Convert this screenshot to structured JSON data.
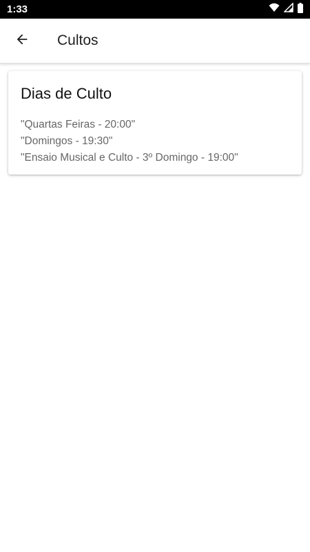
{
  "status_bar": {
    "time": "1:33",
    "icons": [
      "wifi-icon",
      "signal-icon",
      "battery-icon"
    ]
  },
  "app_bar": {
    "back_icon": "arrow-left-icon",
    "title": "Cultos"
  },
  "card": {
    "title": "Dias de Culto",
    "items": [
      "\"Quartas Feiras - 20:00\"",
      "\"Domingos - 19:30\"",
      "\"Ensaio Musical e Culto - 3º Domingo - 19:00\""
    ]
  },
  "colors": {
    "status_bar_bg": "#000000",
    "app_bar_bg": "#ffffff",
    "title_text": "#222222",
    "secondary_text": "#666666"
  }
}
